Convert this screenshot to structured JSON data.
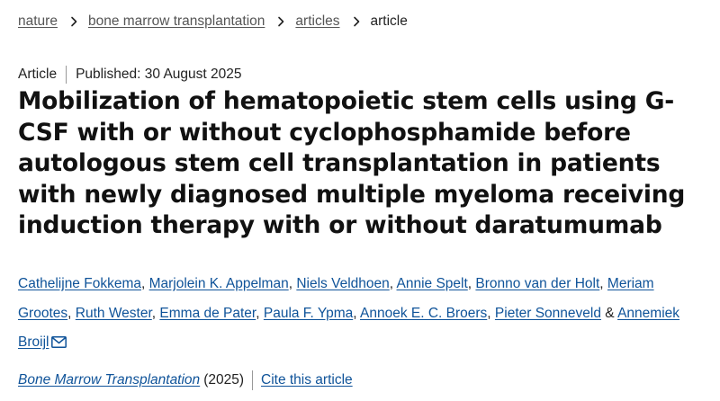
{
  "breadcrumb": {
    "items": [
      {
        "label": "nature"
      },
      {
        "label": "bone marrow transplantation"
      },
      {
        "label": "articles"
      }
    ],
    "current": "article"
  },
  "meta": {
    "type": "Article",
    "published": "Published: 30 August 2025"
  },
  "article": {
    "title": "Mobilization of hematopoietic stem cells using G-CSF with or without cyclophosphamide before autologous stem cell transplantation in patients with newly diagnosed multiple myeloma receiving induction therapy with or without daratumumab"
  },
  "authors": {
    "list": [
      "Cathelijne Fokkema",
      "Marjolein K. Appelman",
      "Niels Veldhoen",
      "Annie Spelt",
      "Bronno van der Holt",
      "Meriam Grootes",
      "Ruth Wester",
      "Emma de Pater",
      "Paula F. Ypma",
      "Annoek E. C. Broers",
      "Pieter Sonneveld",
      "Annemiek Broijl"
    ],
    "separator": ", ",
    "last_separator": " & ",
    "contact_icon": "envelope-icon"
  },
  "citation": {
    "journal": "Bone Marrow Transplantation",
    "year": "(2025)",
    "cite_label": "Cite this article"
  },
  "colors": {
    "link": "#0f5399",
    "breadcrumb_link": "#555555",
    "text": "#222222"
  }
}
